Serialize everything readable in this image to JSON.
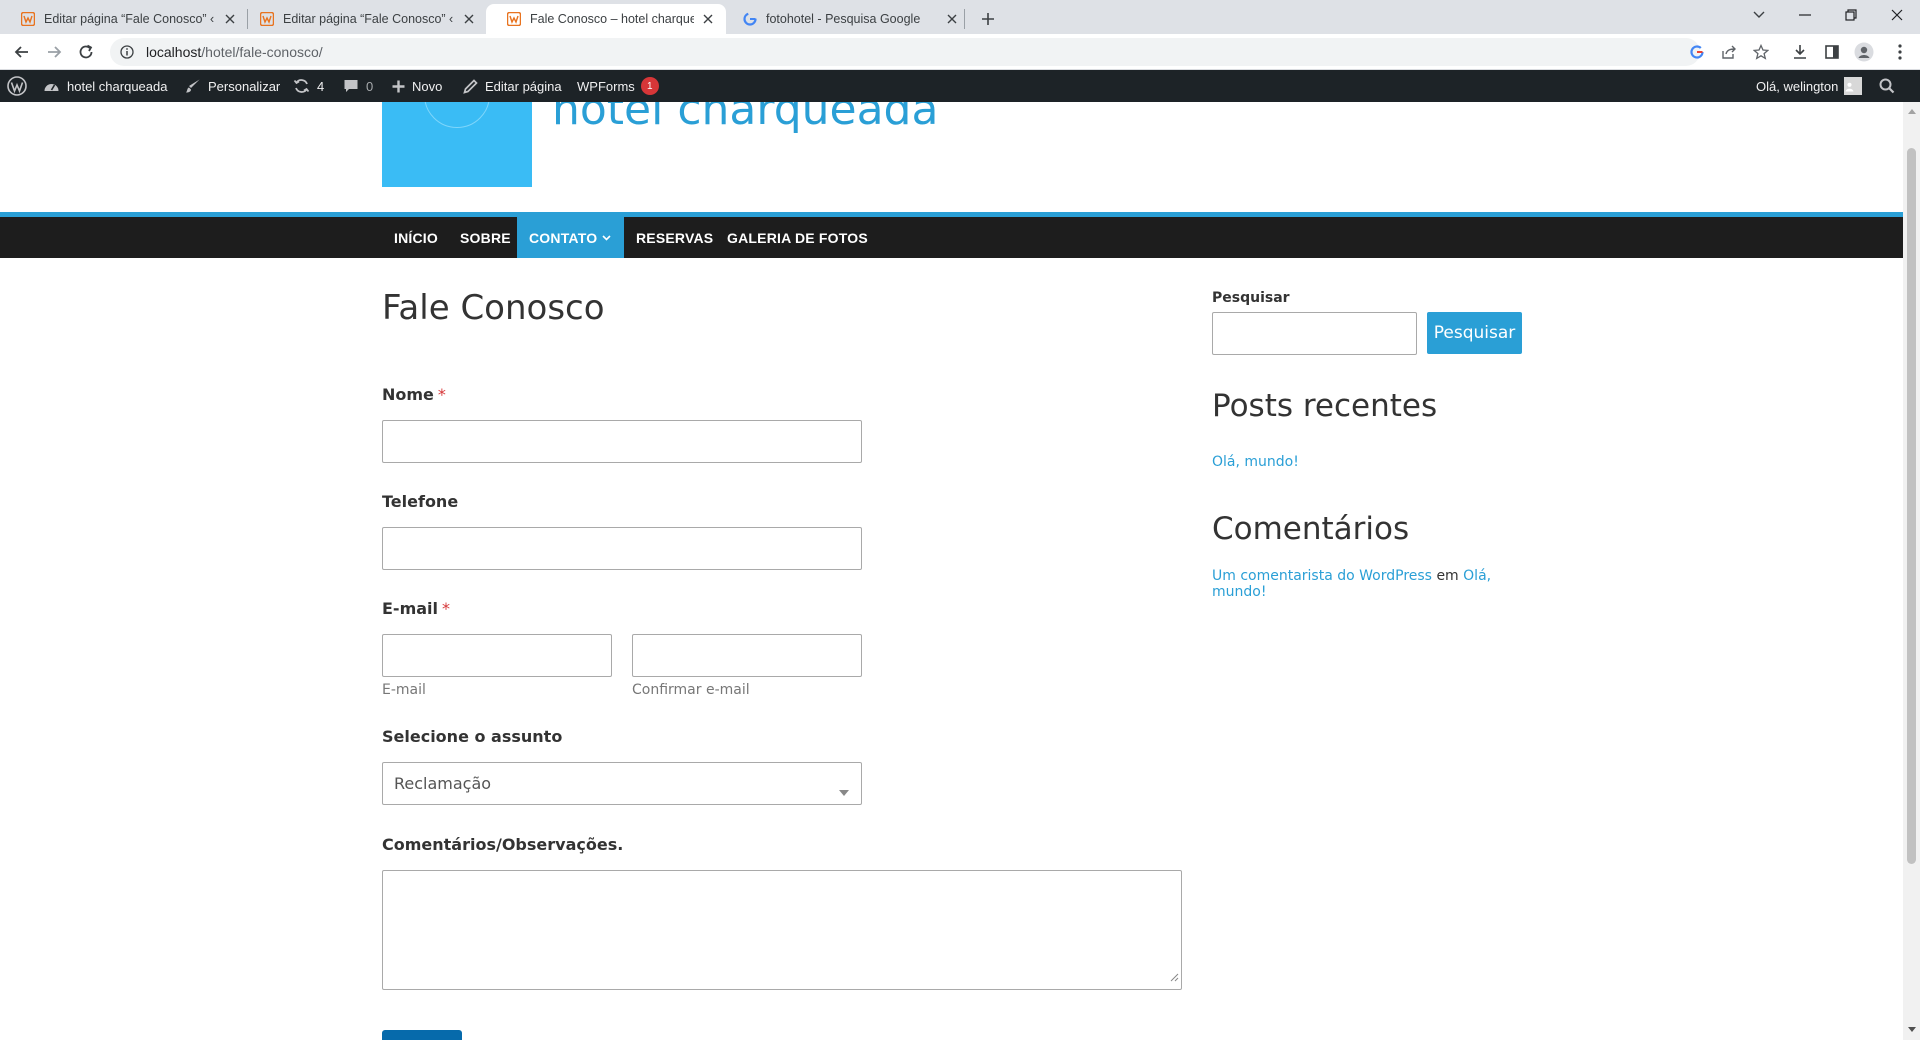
{
  "browser": {
    "tabs": [
      {
        "title": "Editar página “Fale Conosco” ‹ hotel charqueada",
        "favicon": "wordpress-orange-icon",
        "active": false
      },
      {
        "title": "Editar página “Fale Conosco” ‹ hotel charqueada",
        "favicon": "wordpress-orange-icon",
        "active": false
      },
      {
        "title": "Fale Conosco – hotel charqueada",
        "favicon": "wordpress-orange-icon",
        "active": true
      },
      {
        "title": "fotohotel - Pesquisa Google",
        "favicon": "google-icon",
        "active": false
      }
    ],
    "url_host": "localhost",
    "url_path": "/hotel/fale-conosco/"
  },
  "adminbar": {
    "site_name": "hotel charqueada",
    "customize": "Personalizar",
    "updates_count": "4",
    "comments_count": "0",
    "new_label": "Novo",
    "edit_page": "Editar página",
    "wpforms": "WPForms",
    "wpforms_badge": "1",
    "greeting": "Olá, welington"
  },
  "site": {
    "title": "hotel charqueada",
    "logo_color": "#3abcf5",
    "accent": "#2a9fd6"
  },
  "nav": {
    "items": [
      "INÍCIO",
      "SOBRE",
      "CONTATO",
      "RESERVAS",
      "GALERIA DE FOTOS"
    ],
    "current": "CONTATO"
  },
  "page": {
    "title": "Fale Conosco"
  },
  "form": {
    "name_label": "Nome",
    "phone_label": "Telefone",
    "email_label": "E-mail",
    "email_sublabel": "E-mail",
    "email_confirm_sublabel": "Confirmar e-mail",
    "required_mark": "*",
    "subject_label": "Selecione o assunto",
    "subject_value": "Reclamação",
    "comments_label": "Comentários/Observações."
  },
  "sidebar": {
    "search_label": "Pesquisar",
    "search_button": "Pesquisar",
    "recent_posts_title": "Posts recentes",
    "recent_posts": [
      "Olá, mundo!"
    ],
    "comments_title": "Comentários",
    "comment_author": "Um comentarista do WordPress",
    "comment_connector": "em",
    "comment_post_line1": "Olá,",
    "comment_post_line2": "mundo!"
  }
}
